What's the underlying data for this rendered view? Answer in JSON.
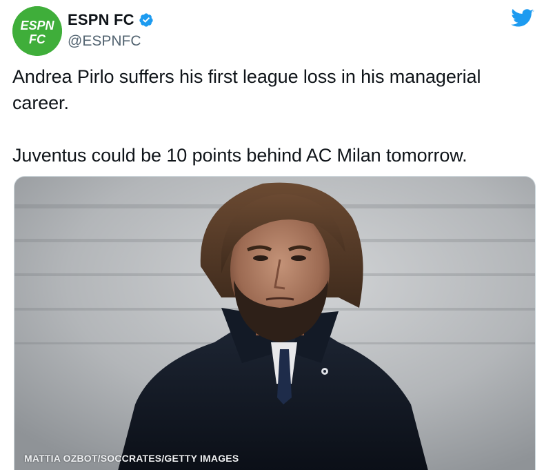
{
  "author": {
    "name": "ESPN FC",
    "handle": "@ESPNFC",
    "verified": true,
    "avatar_text_line1": "ESPN",
    "avatar_text_line2": "FC",
    "avatar_color": "#3fae3a"
  },
  "tweet": {
    "paragraph1": "Andrea Pirlo suffers his first league loss in his managerial career.",
    "paragraph2": "Juventus could be 10 points behind AC Milan tomorrow."
  },
  "media": {
    "photo_credit": "MATTIA OZBOT/SOCCRATES/GETTY IMAGES",
    "description_icon": "portrait-photo"
  },
  "icons": {
    "verified": "verified-badge-icon",
    "brand": "twitter-bird-icon"
  },
  "colors": {
    "verified_blue": "#1d9bf0",
    "twitter_blue": "#1d9bf0",
    "text_primary": "#0f1419",
    "text_secondary": "#536471"
  }
}
